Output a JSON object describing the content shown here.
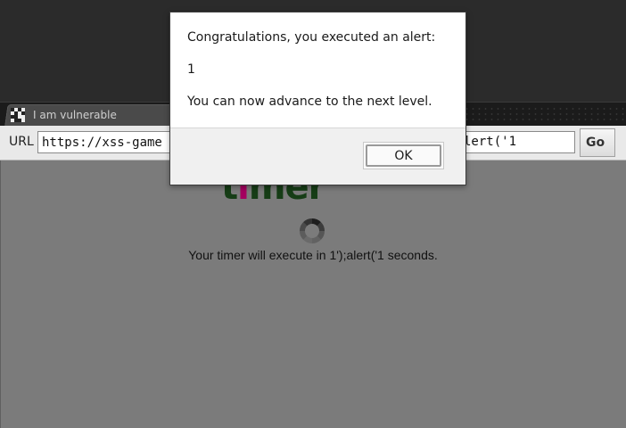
{
  "browser": {
    "tab": {
      "title": "I am vulnerable",
      "icon": "xss-game-favicon-icon"
    },
    "toolbar": {
      "url_label": "URL",
      "url_value": "https://xss-game",
      "url_tail_visible": "lert('1",
      "go_label": "Go"
    }
  },
  "page": {
    "logo": {
      "text_part1": "t",
      "text_accent": "i",
      "text_part2": "mer",
      "color_main": "#163d16",
      "color_accent": "#a4005f"
    },
    "spinner_icon": "loading-spinner-icon",
    "timer_message": "Your timer will execute in 1');alert('1 seconds."
  },
  "dialog": {
    "line1": "Congratulations, you executed an alert:",
    "line2": "1",
    "line3": "You can now advance to the next level.",
    "ok_label": "OK"
  }
}
